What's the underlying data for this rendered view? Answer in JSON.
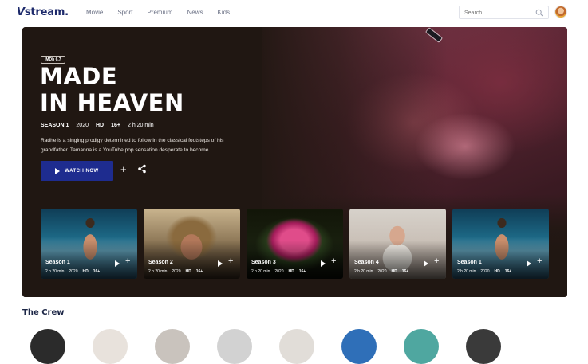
{
  "nav": {
    "logo": "stream.",
    "logo_mark": "V",
    "items": [
      "Movie",
      "Sport",
      "Premium",
      "News",
      "Kids"
    ],
    "search_placeholder": "Search"
  },
  "hero": {
    "rating_badge": "IMDb 6.7",
    "title_line1": "MADE",
    "title_line2": "IN HEAVEN",
    "season": "SEASON 1",
    "year": "2020",
    "quality": "HD",
    "age": "16+",
    "duration": "2 h 20 min",
    "description": "Radhe is a singing prodigy determined to follow in the classical footsteps of his grandfather. Tamanna is a YouTube pop sensation desperate to become .",
    "watch_label": "WATCH NOW",
    "add_symbol": "+"
  },
  "seasons": [
    {
      "title": "Season 1",
      "duration": "2 h 20 min",
      "year": "2020",
      "quality": "HD",
      "age": "16+"
    },
    {
      "title": "Season 2",
      "duration": "2 h 20 min",
      "year": "2020",
      "quality": "HD",
      "age": "16+"
    },
    {
      "title": "Season 3",
      "duration": "2 h 20 min",
      "year": "2020",
      "quality": "HD",
      "age": "16+"
    },
    {
      "title": "Season 4",
      "duration": "2 h 20 min",
      "year": "2020",
      "quality": "HD",
      "age": "16+"
    },
    {
      "title": "Season 1",
      "duration": "2 h 20 min",
      "year": "2020",
      "quality": "HD",
      "age": "16+"
    }
  ],
  "crew": {
    "heading": "The Crew"
  },
  "colors": {
    "brand": "#1d2a6b",
    "button": "#1e2c8f",
    "hero_bg": "#201712"
  }
}
